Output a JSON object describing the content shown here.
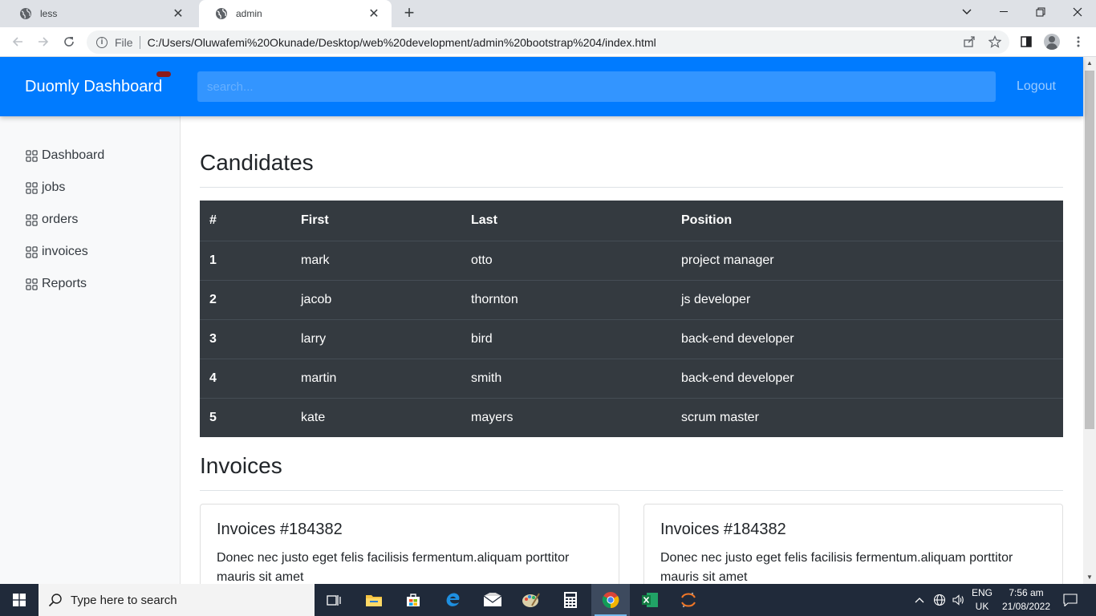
{
  "browser": {
    "tabs": [
      {
        "title": "less"
      },
      {
        "title": "admin"
      }
    ],
    "address": {
      "scheme": "File",
      "url": "C:/Users/Oluwafemi%20Okunade/Desktop/web%20development/admin%20bootstrap%204/index.html"
    }
  },
  "navbar": {
    "brand": "Duomly Dashboard",
    "search_placeholder": "search...",
    "logout": "Logout",
    "brand_color": "#007bff",
    "badge_color": "#8b1a1a"
  },
  "sidebar": {
    "items": [
      {
        "label": "Dashboard",
        "icon": "grid-icon"
      },
      {
        "label": "jobs",
        "icon": "grid-icon"
      },
      {
        "label": "orders",
        "icon": "grid-icon"
      },
      {
        "label": "invoices",
        "icon": "grid-icon"
      },
      {
        "label": "Reports",
        "icon": "grid-icon"
      }
    ]
  },
  "candidates": {
    "title": "Candidates",
    "columns": [
      "#",
      "First",
      "Last",
      "Position"
    ],
    "rows": [
      [
        "1",
        "mark",
        "otto",
        "project manager"
      ],
      [
        "2",
        "jacob",
        "thornton",
        "js developer"
      ],
      [
        "3",
        "larry",
        "bird",
        "back-end developer"
      ],
      [
        "4",
        "martin",
        "smith",
        "back-end developer"
      ],
      [
        "5",
        "kate",
        "mayers",
        "scrum master"
      ]
    ],
    "table_color": "#343a40"
  },
  "invoices": {
    "title": "Invoices",
    "cards": [
      {
        "title": "Invoices #184382",
        "text": "Donec nec justo eget felis facilisis fermentum.aliquam porttitor mauris sit amet"
      },
      {
        "title": "Invoices #184382",
        "text": "Donec nec justo eget felis facilisis fermentum.aliquam porttitor mauris sit amet"
      }
    ]
  },
  "taskbar": {
    "search_placeholder": "Type here to search",
    "apps": [
      "task-view-icon",
      "file-explorer-icon",
      "store-icon",
      "edge-icon",
      "mail-icon",
      "paint-icon",
      "calculator-icon",
      "chrome-icon",
      "excel-icon",
      "jupyter-icon"
    ],
    "language": {
      "line1": "ENG",
      "line2": "UK"
    },
    "clock": {
      "time": "7:56 am",
      "date": "21/08/2022"
    }
  }
}
